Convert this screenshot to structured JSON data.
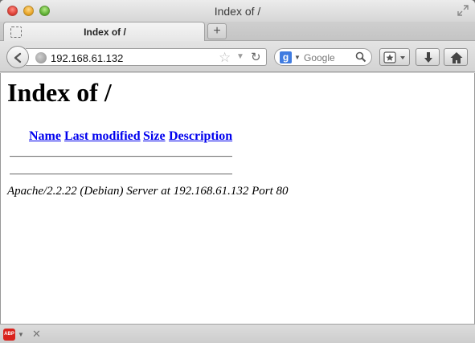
{
  "window": {
    "title": "Index of /"
  },
  "tabs": [
    {
      "label": "Index of /"
    }
  ],
  "toolbar": {
    "url": "192.168.61.132",
    "search_placeholder": "Google",
    "search_engine_letter": "g"
  },
  "page": {
    "heading": "Index of /",
    "columns": [
      "Name",
      "Last modified",
      "Size",
      "Description"
    ],
    "address": "Apache/2.2.22 (Debian) Server at 192.168.61.132 Port 80"
  },
  "statusbar": {
    "addon_label": "ABP"
  },
  "colors": {
    "link": "#0000ee",
    "abp_red": "#d9231d"
  }
}
